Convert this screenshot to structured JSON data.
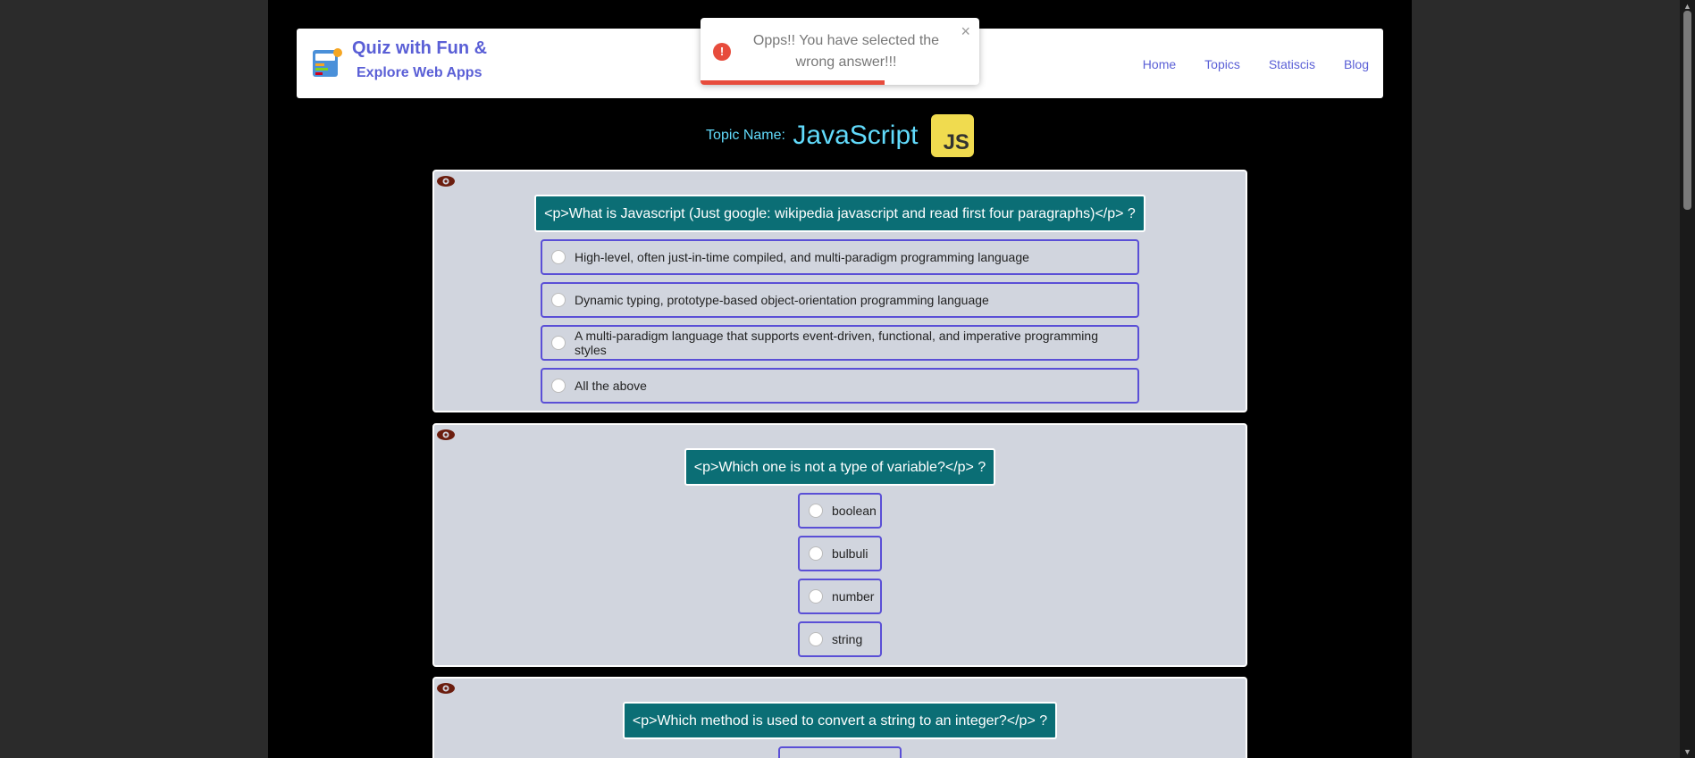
{
  "navbar": {
    "brand_line1": "Quiz with Fun &",
    "brand_line2": "Explore Web Apps",
    "logo_icon": "quiz-app-icon",
    "links": [
      "Home",
      "Topics",
      "Statiscis",
      "Blog"
    ]
  },
  "toast": {
    "message": "Opps!! You have selected the wrong answer!!!",
    "icon": "error-icon",
    "close": "×",
    "progress_fraction": 0.66,
    "color": "#e74c3c"
  },
  "topic": {
    "label": "Topic Name:",
    "name": "JavaScript",
    "badge": "JS"
  },
  "questions": [
    {
      "text": "<p>What is Javascript (Just google: wikipedia javascript and read first four paragraphs)</p> ?",
      "options": [
        "High-level, often just-in-time compiled, and multi-paradigm programming language",
        "Dynamic typing, prototype-based object-orientation programming language",
        "A multi-paradigm language that supports event-driven, functional, and imperative programming styles",
        "All the above"
      ]
    },
    {
      "text": "<p>Which one is not a type of variable?</p> ?",
      "options": [
        "boolean",
        "bulbuli",
        "number",
        "string"
      ]
    },
    {
      "text": "<p>Which method is used to convert a string to an integer?</p> ?",
      "options": [
        ""
      ]
    }
  ],
  "colors": {
    "accent": "#5a5fd6",
    "question_bg": "#0b6e75",
    "card_bg": "#d1d5de",
    "js_yellow": "#f0db4f",
    "topic_text": "#61dafb"
  }
}
